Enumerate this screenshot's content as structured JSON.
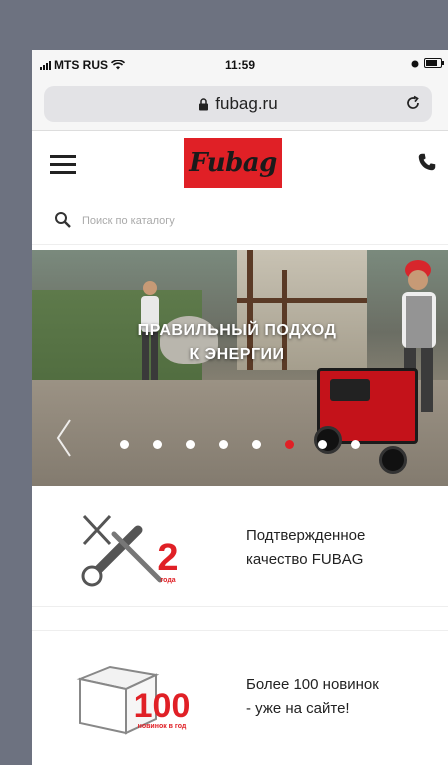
{
  "status_bar": {
    "carrier": "MTS RUS",
    "time": "11:59"
  },
  "url_bar": {
    "domain": "fubag.ru"
  },
  "header": {
    "logo_text": "Fubag"
  },
  "search": {
    "placeholder": "Поиск по каталогу"
  },
  "banner": {
    "title_line1": "ПРАВИЛЬНЫЙ ПОДХОД",
    "title_line2": "К ЭНЕРГИИ",
    "slides": 8,
    "active_slide": 6
  },
  "features": [
    {
      "icon": "tools-warranty-icon",
      "badge_number": "2",
      "badge_caption": "года",
      "line1": "Подтвержденное",
      "line2": "качество FUBAG"
    },
    {
      "icon": "box-new-products-icon",
      "badge_number": "100",
      "badge_caption": "новинок в год",
      "line1": "Более 100 новинок",
      "line2": "- уже на сайте!"
    }
  ],
  "colors": {
    "brand_red": "#e02026",
    "backdrop": "#6d7280"
  }
}
